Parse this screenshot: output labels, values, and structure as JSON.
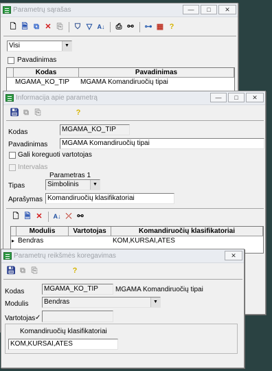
{
  "win1": {
    "title": "Parametrų sąrašas",
    "filter": "Visi",
    "checkbox_label": "Pavadinimas",
    "columns": [
      "Kodas",
      "Pavadinimas"
    ],
    "rows": [
      {
        "kodas": "MGAMA_KO_TIP",
        "pavadinimas": "MGAMA Komandiruočių tipai"
      }
    ]
  },
  "win2": {
    "title": "Informacija apie parametrą",
    "kodas_label": "Kodas",
    "kodas_value": "MGAMA_KO_TIP",
    "pavadinimas_label": "Pavadinimas",
    "pavadinimas_value": "MGAMA Komandiruočių tipai",
    "gali_label": "Gali koreguoti vartotojas",
    "intervalas_label": "Intervalas",
    "param_caption": "Parametras 1",
    "tipas_label": "Tipas",
    "tipas_value": "Simbolinis",
    "aprasymas_label": "Aprašymas",
    "aprasymas_value": "Komandiruočių klasifikatoriai",
    "columns": [
      "Modulis",
      "Vartotojas",
      "Komandiruočių klasifikatoriai"
    ],
    "rows": [
      {
        "modulis": "Bendras",
        "vartotojas": "",
        "klas": "KOM,KURSAI,ATES"
      }
    ]
  },
  "win3": {
    "title": "Parametrų reikšmės koregavimas",
    "kodas_label": "Kodas",
    "kodas_value": "MGAMA_KO_TIP",
    "kodas_desc": "MGAMA Komandiruočių tipai",
    "modulis_label": "Modulis",
    "modulis_value": "Bendras",
    "vartotojas_label": "Vartotojas",
    "vartotojas_mark": "✓",
    "group_label": "Komandiruočių klasifikatoriai",
    "group_value": "KOM,KURSAI,ATES"
  },
  "controls": {
    "minimize": "—",
    "maximize": "□",
    "close": "✕"
  },
  "icons": {
    "new": "new-doc-icon",
    "edit": "edit-doc-icon",
    "copy": "copy-icon",
    "delete": "delete-icon",
    "filter": "filter-icon",
    "sort": "sort-az-icon",
    "print": "print-icon",
    "find": "binoculars-icon",
    "tree": "tree-icon",
    "grid": "grid-icon",
    "help": "help-icon",
    "save": "save-icon"
  }
}
